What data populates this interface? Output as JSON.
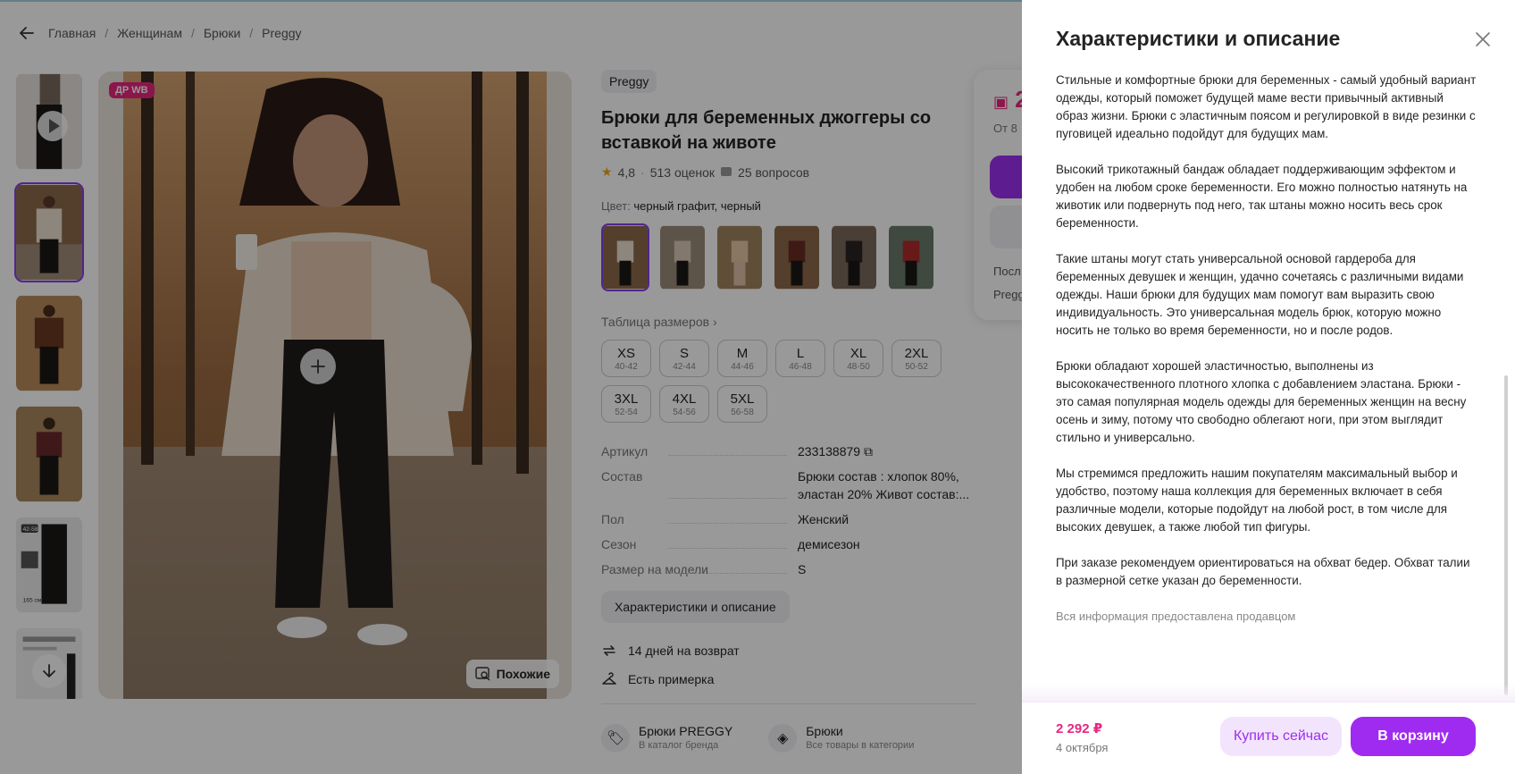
{
  "breadcrumb": {
    "items": [
      "Главная",
      "Женщинам",
      "Брюки",
      "Preggy"
    ],
    "separator": "/"
  },
  "gallery": {
    "badge": "ДР WB",
    "similar_label": "Похожие",
    "thumb_labels": {
      "size": "42-58",
      "height": "165 см"
    }
  },
  "product": {
    "brand": "Preggy",
    "title": "Брюки для беременных джоггеры со вставкой на животе",
    "rating": "4,8",
    "reviews": "513 оценок",
    "questions": "25 вопросов",
    "color_label": "Цвет:",
    "color_value": "черный графит, черный",
    "size_table_label": "Таблица размеров",
    "sizes": [
      {
        "name": "XS",
        "range": "40-42"
      },
      {
        "name": "S",
        "range": "42-44"
      },
      {
        "name": "M",
        "range": "44-46"
      },
      {
        "name": "L",
        "range": "46-48"
      },
      {
        "name": "XL",
        "range": "48-50"
      },
      {
        "name": "2XL",
        "range": "50-52"
      },
      {
        "name": "3XL",
        "range": "52-54"
      },
      {
        "name": "4XL",
        "range": "54-56"
      },
      {
        "name": "5XL",
        "range": "56-58"
      }
    ],
    "specs": [
      {
        "key": "Артикул",
        "value": "233138879"
      },
      {
        "key": "Состав",
        "value": "Брюки состав : хлопок 80%, эластан 20% Живот состав:..."
      },
      {
        "key": "Пол",
        "value": "Женский"
      },
      {
        "key": "Сезон",
        "value": "демисезон"
      },
      {
        "key": "Размер на модели",
        "value": "S"
      }
    ],
    "char_button": "Характеристики и описание",
    "return_label": "14 дней на возврат",
    "fitting_label": "Есть примерка",
    "brand_link": {
      "title": "Брюки PREGGY",
      "sub": "В каталог бренда"
    },
    "category_link": {
      "title": "Брюки",
      "sub": "Все товары в категории"
    }
  },
  "price_card": {
    "price_partial": "2",
    "from_partial": "От 8",
    "line1_partial": "Посл",
    "line2_partial": "Pregg"
  },
  "drawer": {
    "title": "Характеристики и описание",
    "paragraphs": [
      "Стильные и комфортные брюки для беременных - самый удобный вариант одежды, который поможет будущей маме вести привычный активный образ жизни. Брюки с эластичным поясом и регулировкой в виде резинки с пуговицей идеально подойдут для будущих мам.",
      "Высокий трикотажный бандаж обладает поддерживающим эффектом и удобен на любом сроке беременности. Его можно полностью натянуть на животик или подвернуть под него, так штаны можно носить весь срок беременности.",
      "Такие штаны могут стать универсальной основой гардероба для беременных девушек и женщин, удачно сочетаясь с различными видами одежды. Наши брюки для будущих мам помогут вам выразить свою индивидуальность. Это универсальная модель брюк, которую можно носить не только во время беременности, но и после родов.",
      "Брюки обладают хорошей эластичностью, выполнены из высококачественного плотного хлопка с добавлением эластана. Брюки - это самая популярная модель одежды для беременных женщин на весну осень и зиму, потому что свободно облегают ноги, при этом выглядит стильно и универсально.",
      "Мы стремимся предложить нашим покупателям максимальный выбор и удобство, поэтому наша коллекция для беременных включает в себя различные модели, которые подойдут на любой рост, в том числе для высоких девушек, а также любой тип фигуры.",
      "При заказе рекомендуем ориентироваться на обхват бедер. Обхват талии в размерной сетке указан до беременности."
    ],
    "source_note": "Вся информация предоставлена продавцом",
    "price": "2 292 ₽",
    "delivery_date": "4 октября",
    "buy_now": "Купить сейчас",
    "add_to_cart": "В корзину"
  },
  "colors": {
    "accent": "#a02bf0",
    "accent_light": "#f3e4fd",
    "price": "#e8267e",
    "badge": "#e8267e"
  }
}
